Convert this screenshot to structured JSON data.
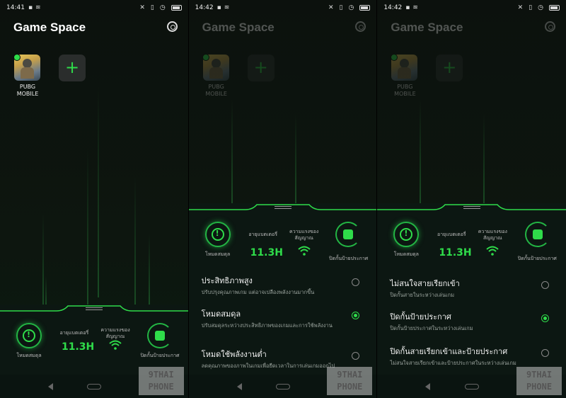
{
  "status": {
    "screens": [
      {
        "time": "14:41"
      },
      {
        "time": "14:42"
      },
      {
        "time": "14:42"
      }
    ]
  },
  "app": {
    "title": "Game Space",
    "games": [
      {
        "name": "PUBG\nMOBILE"
      }
    ],
    "add_label": "+"
  },
  "stats": {
    "mode_label": "โหมดสมดุล",
    "battery_label": "อายุแบตเตอรี่",
    "battery_value": "11.3H",
    "signal_label": "ความแรงของสัญญาณ",
    "block_label": "ปิดกั้นป้ายประกาศ"
  },
  "performance_options": [
    {
      "title": "ประสิทธิภาพสูง",
      "subtitle": "ปรับปรุงคุณภาพเกม แต่อาจเปลืองพลังงานมากขึ้น",
      "selected": false
    },
    {
      "title": "โหมดสมดุล",
      "subtitle": "ปรับสมดุลระหว่างประสิทธิภาพของเกมและการใช้พลังงาน",
      "selected": true
    },
    {
      "title": "โหมดใช้พลังงานต่ำ",
      "subtitle": "ลดคุณภาพของภาพในเกมเพื่อยืดเวลาในการเล่นเกมออกไป",
      "selected": false
    }
  ],
  "notification_options": [
    {
      "title": "ไม่สนใจสายเรียกเข้า",
      "subtitle": "ปิดกั้นสายในระหว่างเล่นเกม",
      "selected": false
    },
    {
      "title": "ปิดกั้นป้ายประกาศ",
      "subtitle": "ปิดกั้นป้ายประกาศในระหว่างเล่นเกม",
      "selected": true
    },
    {
      "title": "ปิดกั้นสายเรียกเข้าและป้ายประกาศ",
      "subtitle": "ไม่สนใจสายเรียกเข้าและป้ายประกาศในระหว่างเล่นเกม",
      "selected": false
    }
  ],
  "watermark": {
    "line1": "9THAI",
    "line2": "PHONE"
  },
  "colors": {
    "accent": "#2fdc4a",
    "panel": "#0c1712",
    "background": "#0a0d0b"
  }
}
